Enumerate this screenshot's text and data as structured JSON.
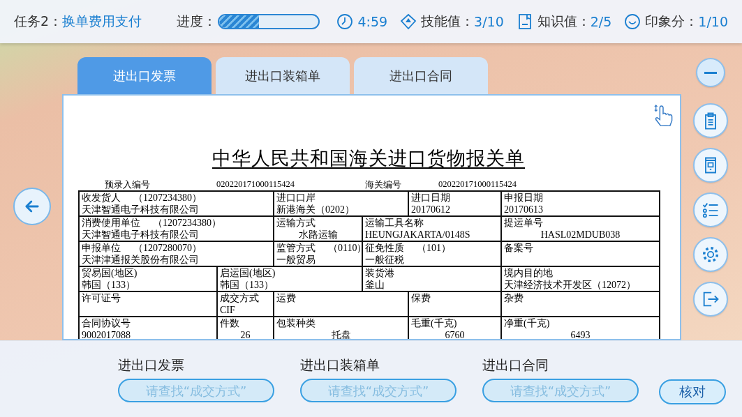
{
  "task": {
    "label": "任务2：",
    "name": "换单费用支付"
  },
  "progress": {
    "label": "进度：",
    "level": 0.4
  },
  "stats": [
    {
      "kind": "timer",
      "value": "4:59"
    },
    {
      "kind": "skill",
      "label": "技能值：",
      "value": "3/10"
    },
    {
      "kind": "knowledge",
      "label": "知识值：",
      "value": "2/5"
    },
    {
      "kind": "impression",
      "label": "印象分：",
      "value": "1/10"
    }
  ],
  "tabs": [
    {
      "label": "进出口发票",
      "selected": true
    },
    {
      "label": "进出口装箱单",
      "selected": false
    },
    {
      "label": "进出口合同",
      "selected": false
    }
  ],
  "document": {
    "title": "中华人民共和国海关进口货物报关单",
    "pre_entry": {
      "label": "预录入编号",
      "value": "020220171000115424"
    },
    "customs_no": {
      "label": "海关编号",
      "value": "020220171000115424"
    },
    "rows": [
      [
        {
          "label": "收发货人",
          "code": "（1207234380）",
          "value": "天津智通电子科技有限公司"
        },
        {
          "label": "进口口岸",
          "value": "新港海关（0202）"
        },
        {
          "label": "进口日期",
          "value": "20170612"
        },
        {
          "label": "申报日期",
          "value": "20170613"
        }
      ],
      [
        {
          "label": "消费使用单位",
          "code": "（1207234380）",
          "value": "天津智通电子科技有限公司"
        },
        {
          "label": "运输方式",
          "value": "水路运输"
        },
        {
          "label": "运输工具名称",
          "value": "HEUNGJAKARTA/0148S"
        },
        {
          "label": "提运单号",
          "value": "HASL02MDUB038"
        }
      ],
      [
        {
          "label": "申报单位",
          "code": "（1207280070）",
          "value": "天津津通报关股份有限公司"
        },
        {
          "label": "监管方式",
          "code": "（0110）",
          "value": "一般贸易"
        },
        {
          "label": "征免性质",
          "code": "（101）",
          "value": "一般征税"
        },
        {
          "label": "备案号"
        }
      ],
      [
        {
          "label": "贸易国(地区)",
          "value": "韩国（133）"
        },
        {
          "label": "启运国(地区)",
          "value": "韩国（133）"
        },
        {
          "label": "装货港",
          "value": "釜山"
        },
        {
          "label": "境内目的地",
          "value": "天津经济技术开发区（12072）"
        }
      ],
      [
        {
          "label": "许可证号"
        },
        {
          "label": "成交方式",
          "value": "CIF"
        },
        {
          "label": "运费"
        },
        {
          "label": "保费"
        },
        {
          "label": "杂费"
        }
      ],
      [
        {
          "label": "合同协议号",
          "value": "9002017088"
        },
        {
          "label": "件数",
          "value": "26"
        },
        {
          "label": "包装种类",
          "value": "托盘"
        },
        {
          "label": "毛重(千克)",
          "value": "6760"
        },
        {
          "label": "净重(千克)",
          "value": "6493"
        }
      ]
    ]
  },
  "answer_fields": [
    {
      "title": "进出口发票",
      "placeholder": "请查找“成交方式”"
    },
    {
      "title": "进出口装箱单",
      "placeholder": "请查找“成交方式”"
    },
    {
      "title": "进出口合同",
      "placeholder": "请查找“成交方式”"
    }
  ],
  "check_button": "核对"
}
